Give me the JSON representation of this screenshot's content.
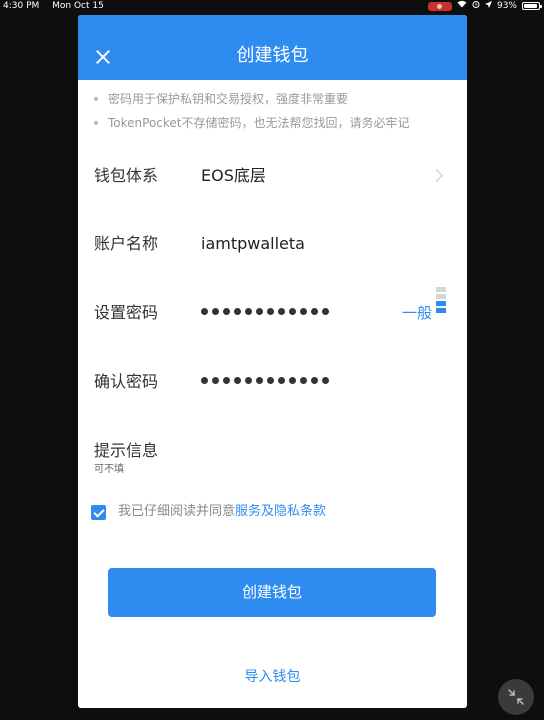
{
  "status_bar": {
    "time": "4:30 PM",
    "date": "Mon Oct 15",
    "battery": "93%"
  },
  "dialog": {
    "title": "创建钱包",
    "tips": [
      "密码用于保护私钥和交易授权，强度非常重要",
      "TokenPocket不存储密码，也无法帮您找回，请务必牢记"
    ],
    "fields": {
      "wallet_system": {
        "label": "钱包体系",
        "value": "EOS底层"
      },
      "account_name": {
        "label": "账户名称",
        "value": "iamtpwalleta"
      },
      "set_password": {
        "label": "设置密码",
        "masked_length": 12,
        "strength_label": "一般",
        "strength_level": 2,
        "strength_max": 4
      },
      "confirm_password": {
        "label": "确认密码",
        "masked_length": 12
      },
      "hint": {
        "label": "提示信息",
        "sublabel": "可不填"
      }
    },
    "agreement": {
      "checked": true,
      "text": "我已仔细阅读并同意",
      "link": "服务及隐私条款"
    },
    "create_button": "创建钱包",
    "import_link": "导入钱包"
  },
  "colors": {
    "accent": "#2e8cf0",
    "background": "#0e0e0e"
  }
}
